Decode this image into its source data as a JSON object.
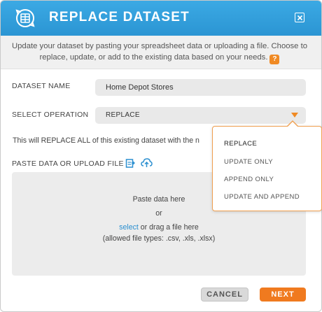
{
  "header": {
    "title": "REPLACE DATASET",
    "logo_icon": "dataset-refresh-icon",
    "close_icon": "close-icon"
  },
  "intro": {
    "text": "Update your dataset by pasting your spreadsheet data or uploading a file. Choose to replace, update, or add to the existing data based on your needs.",
    "help_icon": "?"
  },
  "form": {
    "dataset_name_label": "DATASET NAME",
    "dataset_name_value": "Home Depot Stores",
    "operation_label": "SELECT OPERATION",
    "operation_value": "REPLACE",
    "info_text": "This will REPLACE ALL of this existing dataset with the n",
    "paste_label": "PASTE DATA OR UPLOAD FILE"
  },
  "upload": {
    "line1": "Paste data here",
    "line2": "or",
    "select_link": "select",
    "line3_rest": " or drag a file here",
    "line4": "(allowed file types: .csv, .xls, .xlsx)"
  },
  "dropdown": {
    "options": [
      "REPLACE",
      "UPDATE ONLY",
      "APPEND ONLY",
      "UPDATE AND APPEND"
    ]
  },
  "buttons": {
    "cancel": "CANCEL",
    "next": "NEXT"
  },
  "colors": {
    "header": "#2b95d3",
    "accent": "#f07a1f",
    "link": "#2b8fd0"
  }
}
